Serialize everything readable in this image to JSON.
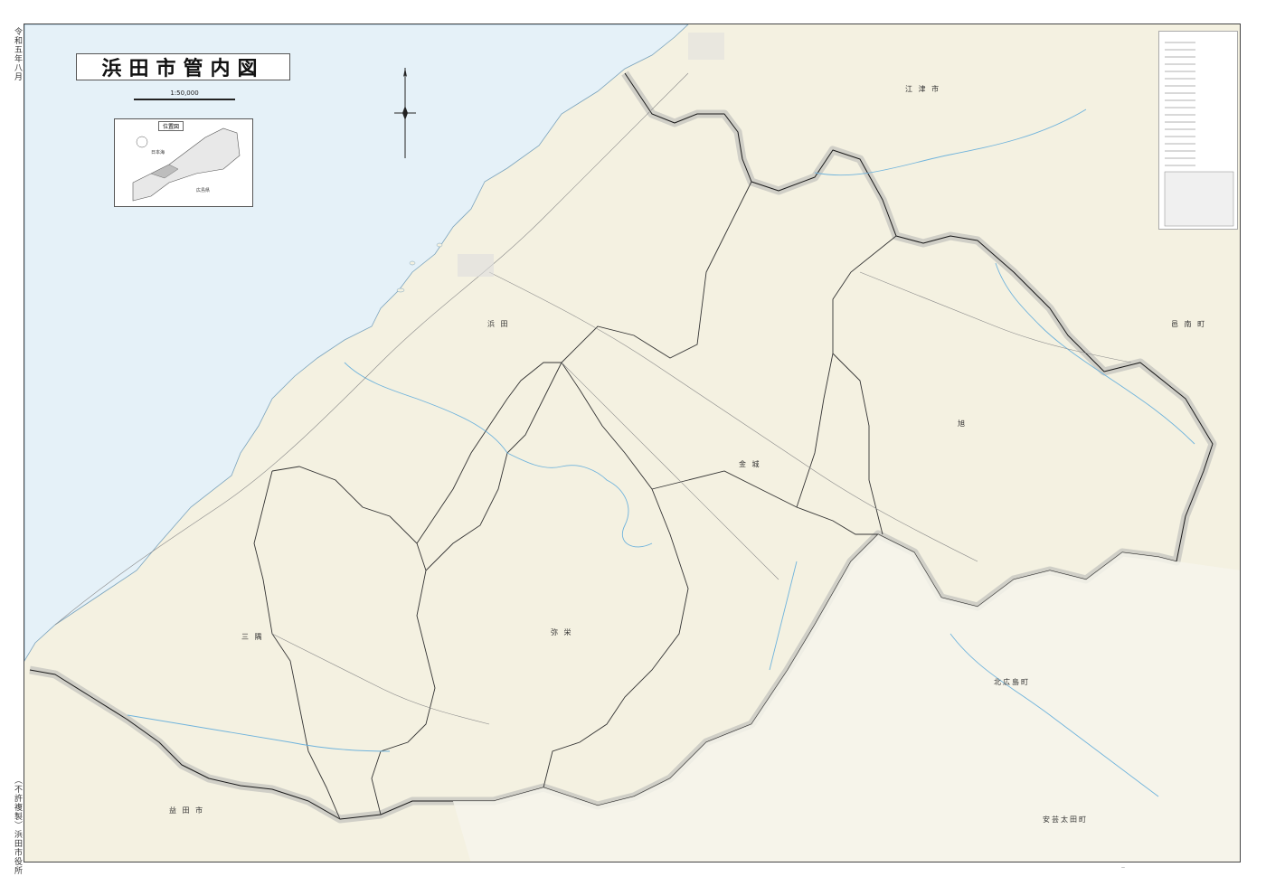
{
  "title": "浜田市管内図",
  "scale": {
    "label": "1:50,000"
  },
  "edition": "令和五年八月",
  "copyright": "（不許複製）浜田市役所",
  "inset": {
    "title": "位置図",
    "labels": [
      "日本海",
      "広島県"
    ]
  },
  "places": {
    "hamada": "浜 田",
    "kanagi": "金 城",
    "asahi": "旭",
    "yasaka": "弥 栄",
    "misumi": "三 隅",
    "gotsu": "江 津 市",
    "onan": "邑 南 町",
    "kitahiroshima": "北広島町",
    "akiota": "安芸太田町",
    "masuda": "益 田 市"
  },
  "colors": {
    "sea": "#e5f1f8",
    "land": "#f4f1e1",
    "border": "#1a1a1a",
    "river": "#6fb3dc",
    "road": "#8a8a8a",
    "prefecture_band": "#c9c9c2"
  },
  "icons": [
    "compass-rose-icon"
  ]
}
